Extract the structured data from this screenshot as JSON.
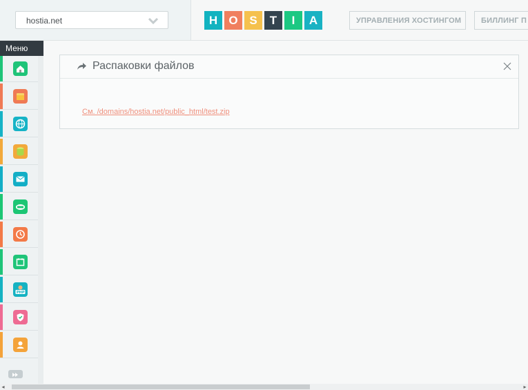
{
  "domain_select": {
    "value": "hostia.net"
  },
  "logo": {
    "letters": [
      "H",
      "O",
      "S",
      "T",
      "I",
      "A"
    ],
    "colors": [
      "#12b3c0",
      "#f07f5e",
      "#f5c14e",
      "#34444f",
      "#1cc882",
      "#19b2c3"
    ]
  },
  "nav": {
    "hosting": "УПРАВЛЕНИЯ ХОСТИНГОМ",
    "billing": "БИЛЛИНГ П"
  },
  "sidebar": {
    "menu_label": "Меню",
    "items": [
      {
        "icon": "home-icon",
        "color": "#1fc479"
      },
      {
        "icon": "folder-icon",
        "color": "#ef7a55"
      },
      {
        "icon": "globe-icon",
        "color": "#16b3c6"
      },
      {
        "icon": "database-icon",
        "color": "#f2a93b"
      },
      {
        "icon": "mail-icon",
        "color": "#13aec6"
      },
      {
        "icon": "ftp-icon",
        "color": "#1cc674"
      },
      {
        "icon": "clock-icon",
        "color": "#f37a48"
      },
      {
        "icon": "calendar-icon",
        "color": "#1fc479"
      },
      {
        "icon": "php-icon",
        "color": "#15b2c2"
      },
      {
        "icon": "shield-icon",
        "color": "#ee6b93"
      },
      {
        "icon": "user-support-icon",
        "color": "#f4a33a"
      }
    ],
    "more_icon": "fast-forward-icon"
  },
  "panel": {
    "title": "Распаковки файлов",
    "link_text": "См. /domains/hostia.net/public_html/test.zip"
  }
}
